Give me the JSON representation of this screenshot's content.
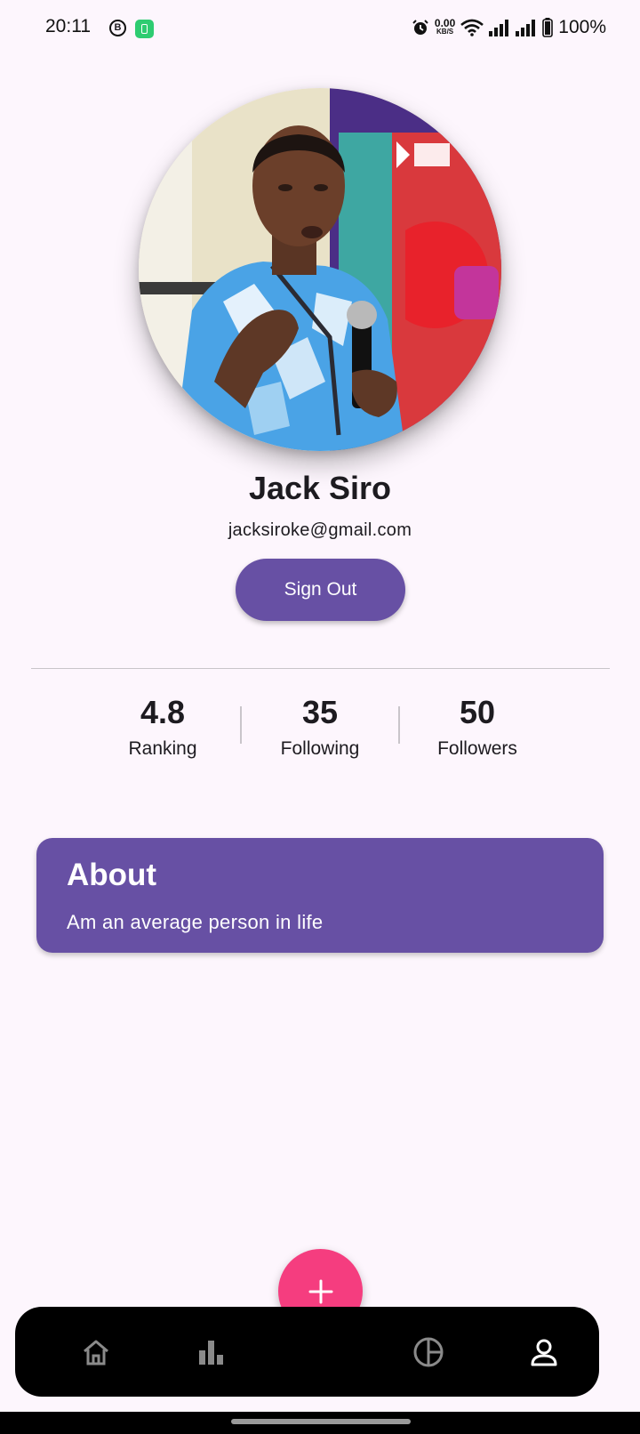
{
  "status_bar": {
    "time": "20:11",
    "badge_letter": "B",
    "net_speed_value": "0.00",
    "net_speed_unit": "KB/S",
    "battery_percent": "100%"
  },
  "profile": {
    "name": "Jack Siro",
    "email": "jacksiroke@gmail.com",
    "sign_out_label": "Sign Out"
  },
  "stats": [
    {
      "value": "4.8",
      "label": "Ranking"
    },
    {
      "value": "35",
      "label": "Following"
    },
    {
      "value": "50",
      "label": "Followers"
    }
  ],
  "about": {
    "title": "About",
    "text": "Am an average person in life"
  },
  "bottom_nav": {
    "items": [
      {
        "icon": "home-icon"
      },
      {
        "icon": "bar-chart-icon"
      },
      {
        "icon": "pie-chart-icon"
      },
      {
        "icon": "person-icon",
        "active": true
      }
    ],
    "fab_icon": "plus-icon"
  },
  "colors": {
    "background": "#fdf6fd",
    "primary": "#6750a4",
    "fab": "#f53d7f",
    "nav_background": "#000000",
    "nav_icon_inactive": "#8a8a8a",
    "nav_icon_active": "#ffffff"
  }
}
